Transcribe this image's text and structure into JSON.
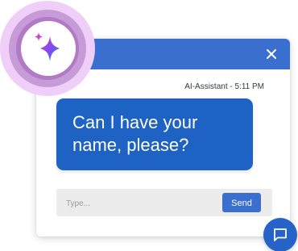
{
  "chat": {
    "sender": "AI-Assistant",
    "time": "5:11 PM",
    "meta_separator": " - ",
    "message": "Can I have your name, please?"
  },
  "composer": {
    "placeholder": "Type...",
    "send_label": "Send"
  },
  "icons": {
    "close": "close-icon",
    "sparkle": "sparkle-icon",
    "chat": "chat-bubble-icon"
  },
  "colors": {
    "header": "#3a6fd0",
    "bubble": "#1e62c4",
    "launcher": "#2563c9",
    "glow": "#efcef8"
  }
}
